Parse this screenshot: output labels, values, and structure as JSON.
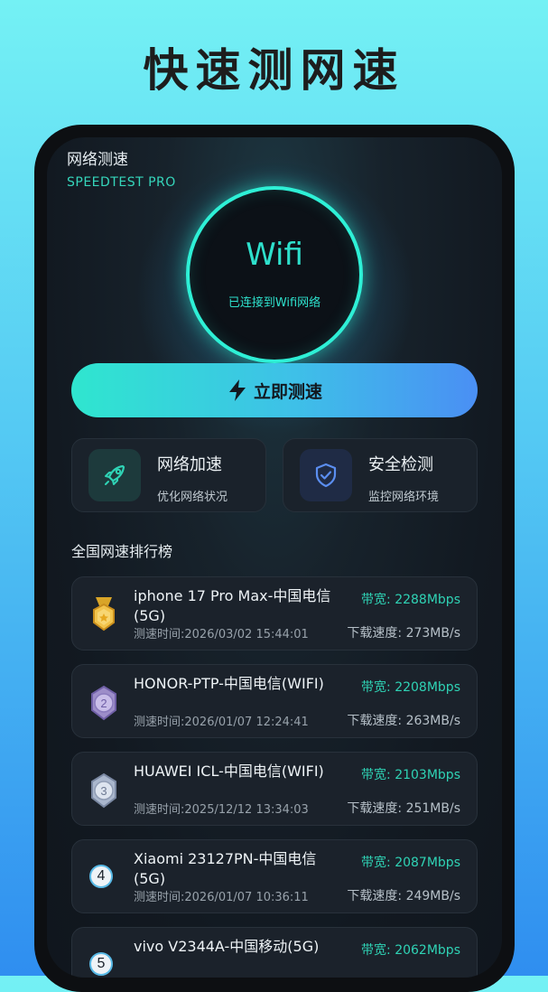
{
  "headline": "快速测网速",
  "app": {
    "title": "网络测速",
    "subtitle": "SPEEDTEST PRO"
  },
  "status": {
    "main": "Wifi",
    "sub": "已连接到Wifi网络"
  },
  "actions": {
    "test_button": "立即测速"
  },
  "features": [
    {
      "title": "网络加速",
      "desc": "优化网络状况",
      "icon": "rocket-icon"
    },
    {
      "title": "安全检测",
      "desc": "监控网络环境",
      "icon": "shield-check-icon"
    }
  ],
  "ranking": {
    "title": "全国网速排行榜",
    "items": [
      {
        "rank": "1",
        "name": "iphone 17 Pro Max-中国电信(5G)",
        "bandwidth": "带宽: 2288Mbps",
        "time": "测速时间:2026/03/02 15:44:01",
        "speed": "下载速度: 273MB/s",
        "badge": "gold-medal-icon"
      },
      {
        "rank": "2",
        "name": "HONOR-PTP-中国电信(WIFI)",
        "bandwidth": "带宽: 2208Mbps",
        "time": "测速时间:2026/01/07 12:24:41",
        "speed": "下载速度: 263MB/s",
        "badge": "silver-medal-icon"
      },
      {
        "rank": "3",
        "name": "HUAWEI ICL-中国电信(WIFI)",
        "bandwidth": "带宽: 2103Mbps",
        "time": "测速时间:2025/12/12 13:34:03",
        "speed": "下载速度: 251MB/s",
        "badge": "bronze-medal-icon"
      },
      {
        "rank": "4",
        "name": "Xiaomi 23127PN-中国电信(5G)",
        "bandwidth": "带宽: 2087Mbps",
        "time": "测速时间:2026/01/07 10:36:11",
        "speed": "下载速度: 249MB/s",
        "badge": ""
      },
      {
        "rank": "5",
        "name": "vivo V2344A-中国移动(5G)",
        "bandwidth": "带宽: 2062Mbps",
        "time": "",
        "speed": "",
        "badge": ""
      }
    ]
  },
  "colors": {
    "accent": "#2ee0cc",
    "bandwidth": "#2fd3b5",
    "background_top": "#74f1f4",
    "background_bottom": "#2f8ef0"
  }
}
